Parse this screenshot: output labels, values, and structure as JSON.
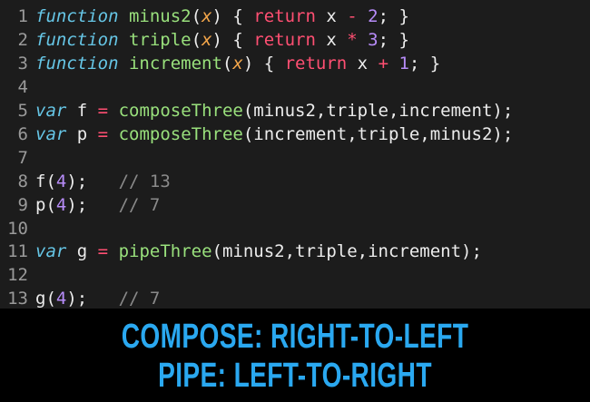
{
  "colors": {
    "background": "#1c1c1c",
    "caption_background": "#000000",
    "keyword": "#66c6e6",
    "function_name": "#99e07c",
    "parameter": "#f4a64a",
    "return_keyword": "#ff4f72",
    "number": "#b78cf9",
    "comment": "#8a8a8a",
    "caption_text": "#2aa8f0"
  },
  "lines": [
    {
      "n": "1",
      "t": [
        "function",
        " ",
        "minus2",
        "(",
        "x",
        ") { ",
        "return",
        " x ",
        "-",
        " ",
        "2",
        "; }"
      ]
    },
    {
      "n": "2",
      "t": [
        "function",
        " ",
        "triple",
        "(",
        "x",
        ") { ",
        "return",
        " x ",
        "*",
        " ",
        "3",
        "; }"
      ]
    },
    {
      "n": "3",
      "t": [
        "function",
        " ",
        "increment",
        "(",
        "x",
        ") { ",
        "return",
        " x ",
        "+",
        " ",
        "1",
        "; }"
      ]
    },
    {
      "n": "4"
    },
    {
      "n": "5",
      "t": [
        "var",
        " f ",
        "=",
        " ",
        "composeThree",
        "(minus2,triple,increment);"
      ]
    },
    {
      "n": "6",
      "t": [
        "var",
        " p ",
        "=",
        " ",
        "composeThree",
        "(increment,triple,minus2);"
      ]
    },
    {
      "n": "7"
    },
    {
      "n": "8",
      "t": [
        "f(",
        "4",
        ");",
        "   ",
        "// 13"
      ]
    },
    {
      "n": "9",
      "t": [
        "p(",
        "4",
        ");",
        "   ",
        "// 7"
      ]
    },
    {
      "n": "10"
    },
    {
      "n": "11",
      "t": [
        "var",
        " g ",
        "=",
        " ",
        "pipeThree",
        "(minus2,triple,increment);"
      ]
    },
    {
      "n": "12"
    },
    {
      "n": "13",
      "t": [
        "g(",
        "4",
        ");",
        "   ",
        "// 7"
      ]
    }
  ],
  "caption": {
    "line1": "COMPOSE: RIGHT-TO-LEFT",
    "line2": "PIPE: LEFT-TO-RIGHT"
  }
}
